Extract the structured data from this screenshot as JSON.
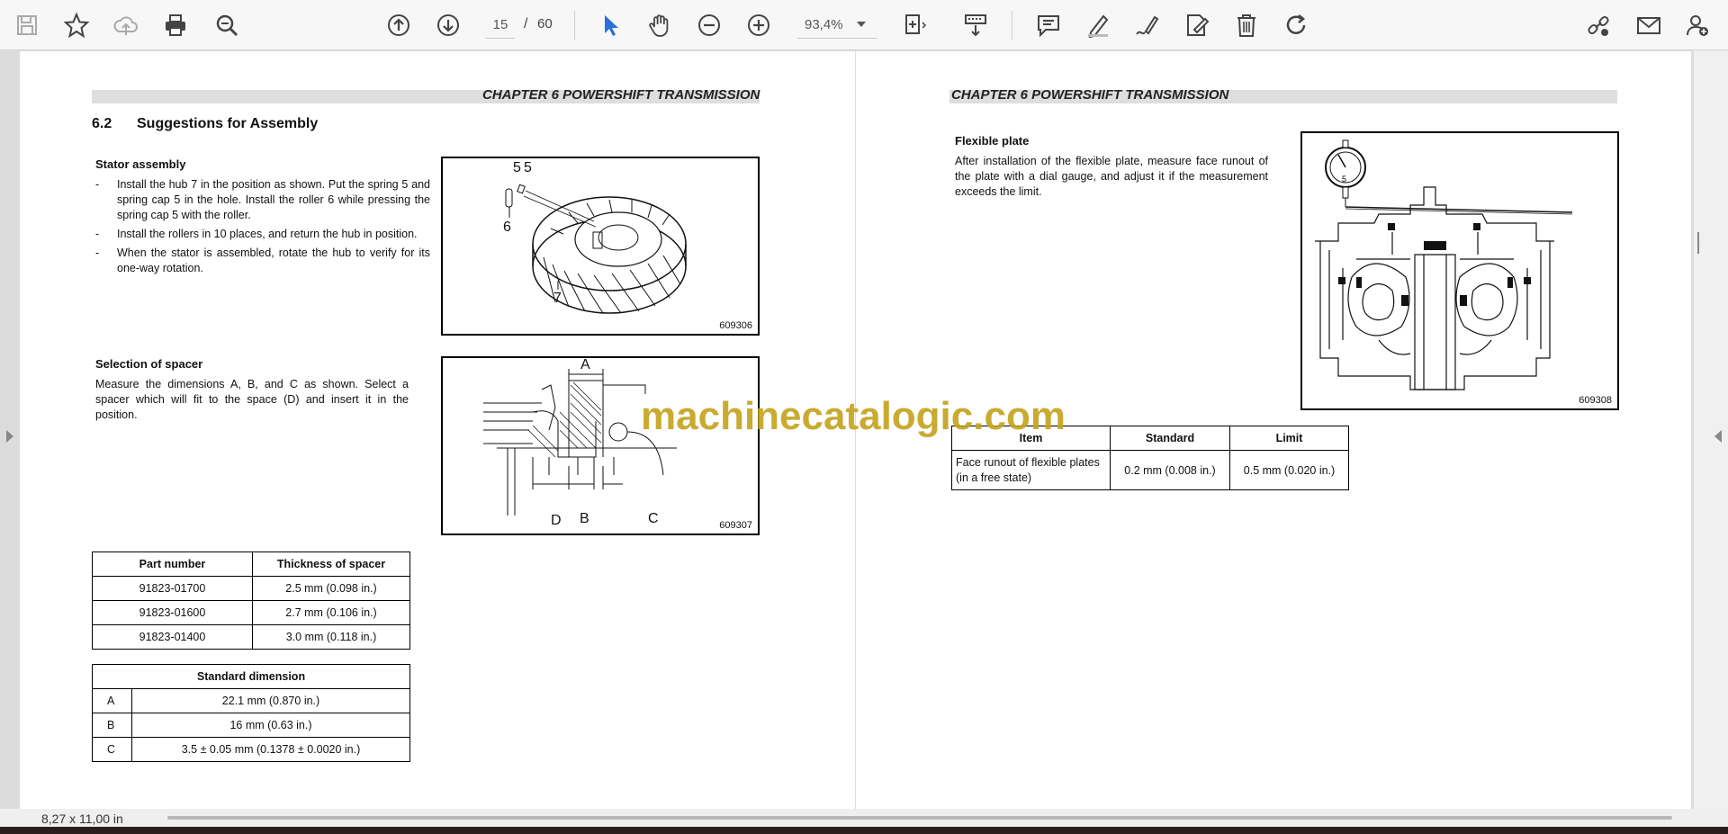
{
  "toolbar": {
    "page_current": "15",
    "page_separator": "/",
    "page_total": "60",
    "zoom": "93,4%"
  },
  "left_page": {
    "chapter_header": "CHAPTER 6 POWERSHIFT TRANSMISSION",
    "section_number": "6.2",
    "section_title": "Suggestions for Assembly",
    "stator": {
      "heading": "Stator assembly",
      "bullets": [
        "Install the hub 7 in the position as shown. Put the spring 5 and spring cap 5 in the hole. Install the roller 6 while pressing the spring cap 5 with the roller.",
        "Install the rollers in 10 places, and return the hub in position.",
        "When the stator is assembled, rotate the hub to verify for its one-way rotation."
      ],
      "figure_number": "609306",
      "figure_labels": [
        "5",
        "5",
        "6",
        "7"
      ]
    },
    "spacer": {
      "heading": "Selection of spacer",
      "text": "Measure the dimensions A, B, and C as shown. Select a spacer which will fit to the space (D) and insert it in the position.",
      "figure_number": "609307",
      "figure_labels": [
        "A",
        "D",
        "B",
        "C"
      ]
    },
    "spacer_table": {
      "headers": [
        "Part number",
        "Thickness of spacer"
      ],
      "rows": [
        [
          "91823-01700",
          "2.5 mm (0.098 in.)"
        ],
        [
          "91823-01600",
          "2.7 mm (0.106 in.)"
        ],
        [
          "91823-01400",
          "3.0 mm (0.118 in.)"
        ]
      ]
    },
    "dimension_table": {
      "header": "Standard dimension",
      "rows": [
        [
          "A",
          "22.1 mm (0.870 in.)"
        ],
        [
          "B",
          "16 mm (0.63 in.)"
        ],
        [
          "C",
          "3.5 ± 0.05 mm (0.1378 ± 0.0020 in.)"
        ]
      ]
    }
  },
  "right_page": {
    "chapter_header": "CHAPTER 6 POWERSHIFT TRANSMISSION",
    "flexible_plate": {
      "heading": "Flexible plate",
      "text": "After installation of the flexible plate, measure face runout of the plate with a dial gauge, and adjust it if the measurement exceeds the limit.",
      "figure_number": "609308"
    },
    "runout_table": {
      "headers": [
        "Item",
        "Standard",
        "Limit"
      ],
      "rows": [
        [
          "Face runout of flexible plates (in a free state)",
          "0.2 mm (0.008 in.)",
          "0.5 mm (0.020 in.)"
        ]
      ]
    }
  },
  "watermark": "machinecatalogic.com",
  "status": {
    "page_size": "8,27 x 11,00 in"
  },
  "icons": [
    "save-icon",
    "bookmark-star-icon",
    "cloud-upload-icon",
    "print-icon",
    "zoom-search-icon",
    "page-up-icon",
    "page-down-icon",
    "cursor-select-icon",
    "hand-pan-icon",
    "zoom-out-icon",
    "zoom-in-icon",
    "fit-page-icon",
    "keyboard-scroll-icon",
    "comment-icon",
    "highlight-pen-icon",
    "sign-icon",
    "edit-doc-icon",
    "delete-icon",
    "rotate-icon",
    "share-link-icon",
    "email-icon",
    "add-user-icon"
  ]
}
